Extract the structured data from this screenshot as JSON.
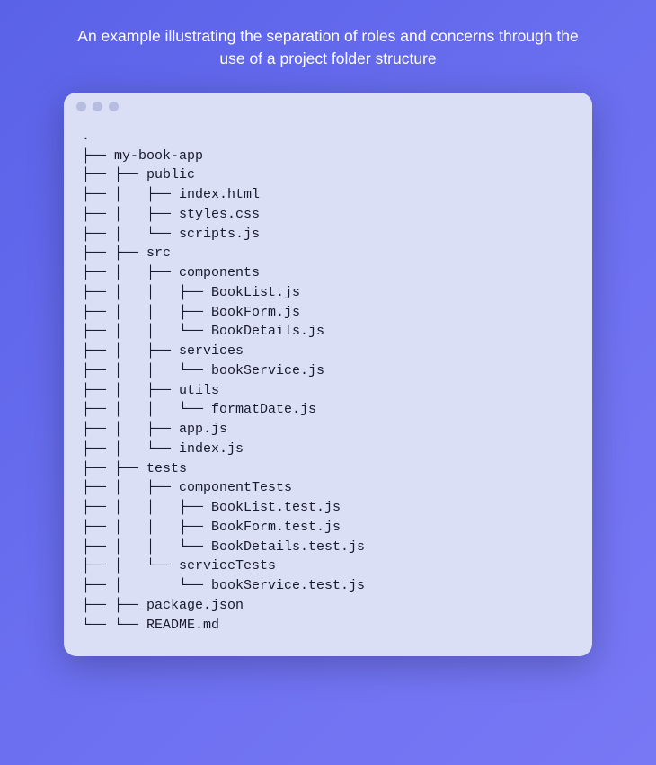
{
  "caption": "An example illustrating the separation of roles and concerns through the use of a project folder structure",
  "tree_lines": [
    ".",
    "├── my-book-app",
    "├── ├── public",
    "├── │   ├── index.html",
    "├── │   ├── styles.css",
    "├── │   └── scripts.js",
    "├── ├── src",
    "├── │   ├── components",
    "├── │   │   ├── BookList.js",
    "├── │   │   ├── BookForm.js",
    "├── │   │   └── BookDetails.js",
    "├── │   ├── services",
    "├── │   │   └── bookService.js",
    "├── │   ├── utils",
    "├── │   │   └── formatDate.js",
    "├── │   ├── app.js",
    "├── │   └── index.js",
    "├── ├── tests",
    "├── │   ├── componentTests",
    "├── │   │   ├── BookList.test.js",
    "├── │   │   ├── BookForm.test.js",
    "├── │   │   └── BookDetails.test.js",
    "├── │   └── serviceTests",
    "├── │       └── bookService.test.js",
    "├── ├── package.json",
    "└── └── README.md"
  ]
}
